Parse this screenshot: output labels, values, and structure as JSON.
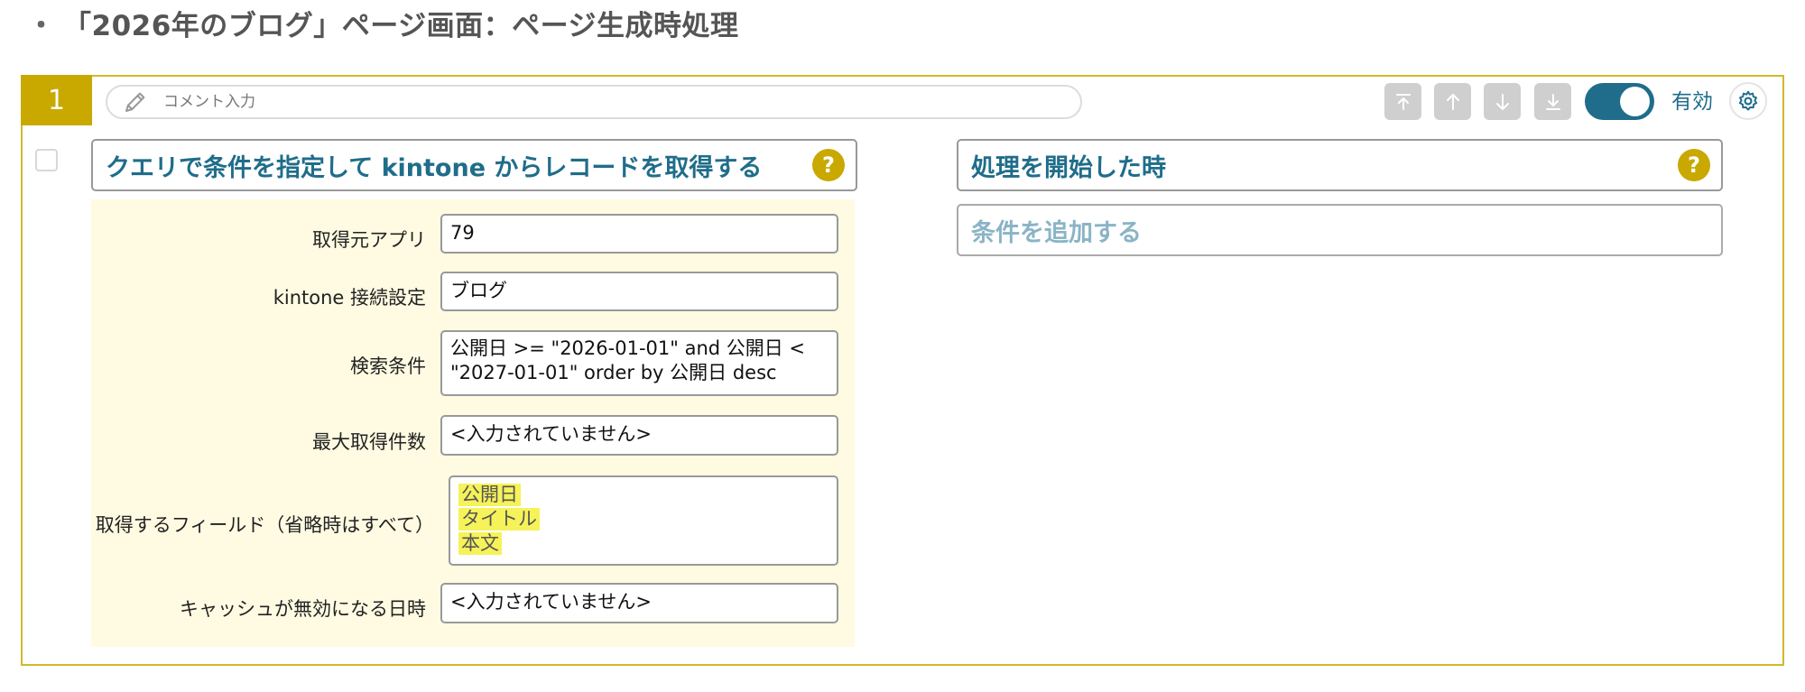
{
  "page": {
    "title": "「2026年のブログ」ページ画面：ページ生成時処理",
    "bullet": "・"
  },
  "step": {
    "number": "1",
    "comment_placeholder": "コメント入力",
    "enabled_label": "有効",
    "enabled": true
  },
  "action": {
    "title": "クエリで条件を指定して kintone からレコードを取得する",
    "help": "?",
    "params": [
      {
        "label": "取得元アプリ",
        "value": "79"
      },
      {
        "label": "kintone 接続設定",
        "value": "ブログ"
      },
      {
        "label": "検索条件",
        "value": "公開日 >= \"2026-01-01\" and 公開日 < \"2027-01-01\" order by 公開日 desc"
      },
      {
        "label": "最大取得件数",
        "value": "<入力されていません>"
      },
      {
        "label": "取得するフィールド（省略時はすべて）",
        "values": [
          "公開日",
          "タイトル",
          "本文"
        ]
      },
      {
        "label": "キャッシュが無効になる日時",
        "value": "<入力されていません>"
      }
    ]
  },
  "trigger": {
    "title": "処理を開始した時",
    "help": "?",
    "add_condition": "条件を追加する"
  },
  "colors": {
    "accent": "#c9a800",
    "primary": "#1f6d8a",
    "highlight": "#f6f25a",
    "param_bg": "#fffbe2"
  }
}
